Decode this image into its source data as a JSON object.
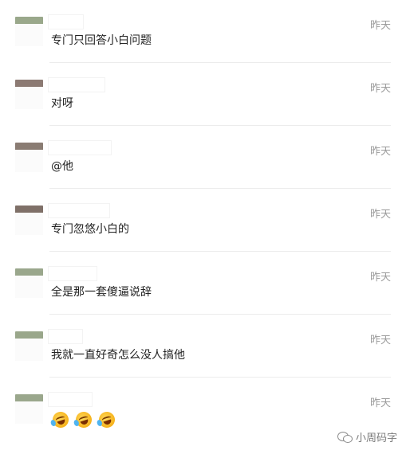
{
  "comments": [
    {
      "time": "昨天",
      "message": "专门只回答小白问题",
      "avatar_color": "#9aa88b"
    },
    {
      "time": "昨天",
      "message": "对呀",
      "avatar_color": "#8c7a73"
    },
    {
      "time": "昨天",
      "message": "@他",
      "avatar_color": "#8a7c73"
    },
    {
      "time": "昨天",
      "message": "专门忽悠小白的",
      "avatar_color": "#7f7068"
    },
    {
      "time": "昨天",
      "message": "全是那一套傻逼说辞",
      "avatar_color": "#9aa78c"
    },
    {
      "time": "昨天",
      "message": "我就一直好奇怎么没人搞他",
      "avatar_color": "#9aa78b"
    },
    {
      "time": "昨天",
      "message": "",
      "avatar_color": "#9aa78c",
      "emojis": [
        "laugh-cry-emoji",
        "laugh-cry-emoji",
        "laugh-cry-emoji"
      ]
    }
  ],
  "watermark": {
    "text": "小周码字",
    "icon": "wechat-icon"
  }
}
